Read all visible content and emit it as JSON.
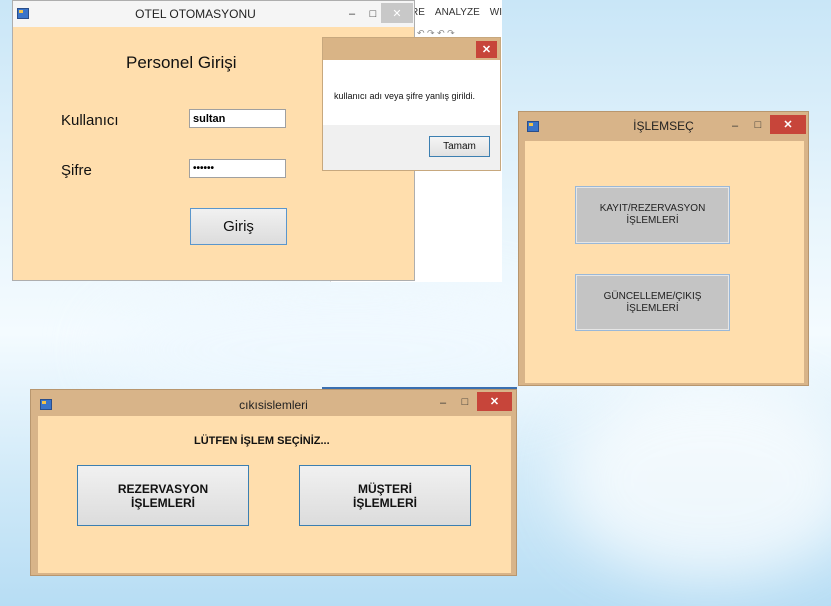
{
  "ide_menu": {
    "items": [
      "RE",
      "ANALYZE",
      "WI"
    ]
  },
  "login_window": {
    "title": "OTEL OTOMASYONU",
    "heading": "Personel Girişi",
    "username_label": "Kullanıcı",
    "username_value": "sultan",
    "password_label": "Şifre",
    "password_value": "••••••",
    "login_button": "Giriş",
    "minimize": "‒",
    "maximize": "□",
    "close": "✕"
  },
  "message_box": {
    "message": "kullanıcı adı veya şifre yanlış girildi.",
    "ok_button": "Tamam",
    "close": "✕"
  },
  "islemsec_window": {
    "title": "İŞLEMSEÇ",
    "button1": "KAYIT/REZERVASYON\nİŞLEMLERİ",
    "button2": "GÜNCELLEME/ÇIKIŞ\nİŞLEMLERİ",
    "minimize": "‒",
    "maximize": "□",
    "close": "✕"
  },
  "cikis_window": {
    "title": "cıkısislemleri",
    "prompt": "LÜTFEN İŞLEM SEÇİNİZ...",
    "button1": "REZERVASYON\nİŞLEMLERİ",
    "button2": "MÜŞTERİ\nİŞLEMLERİ",
    "minimize": "‒",
    "maximize": "□",
    "close": "✕"
  }
}
